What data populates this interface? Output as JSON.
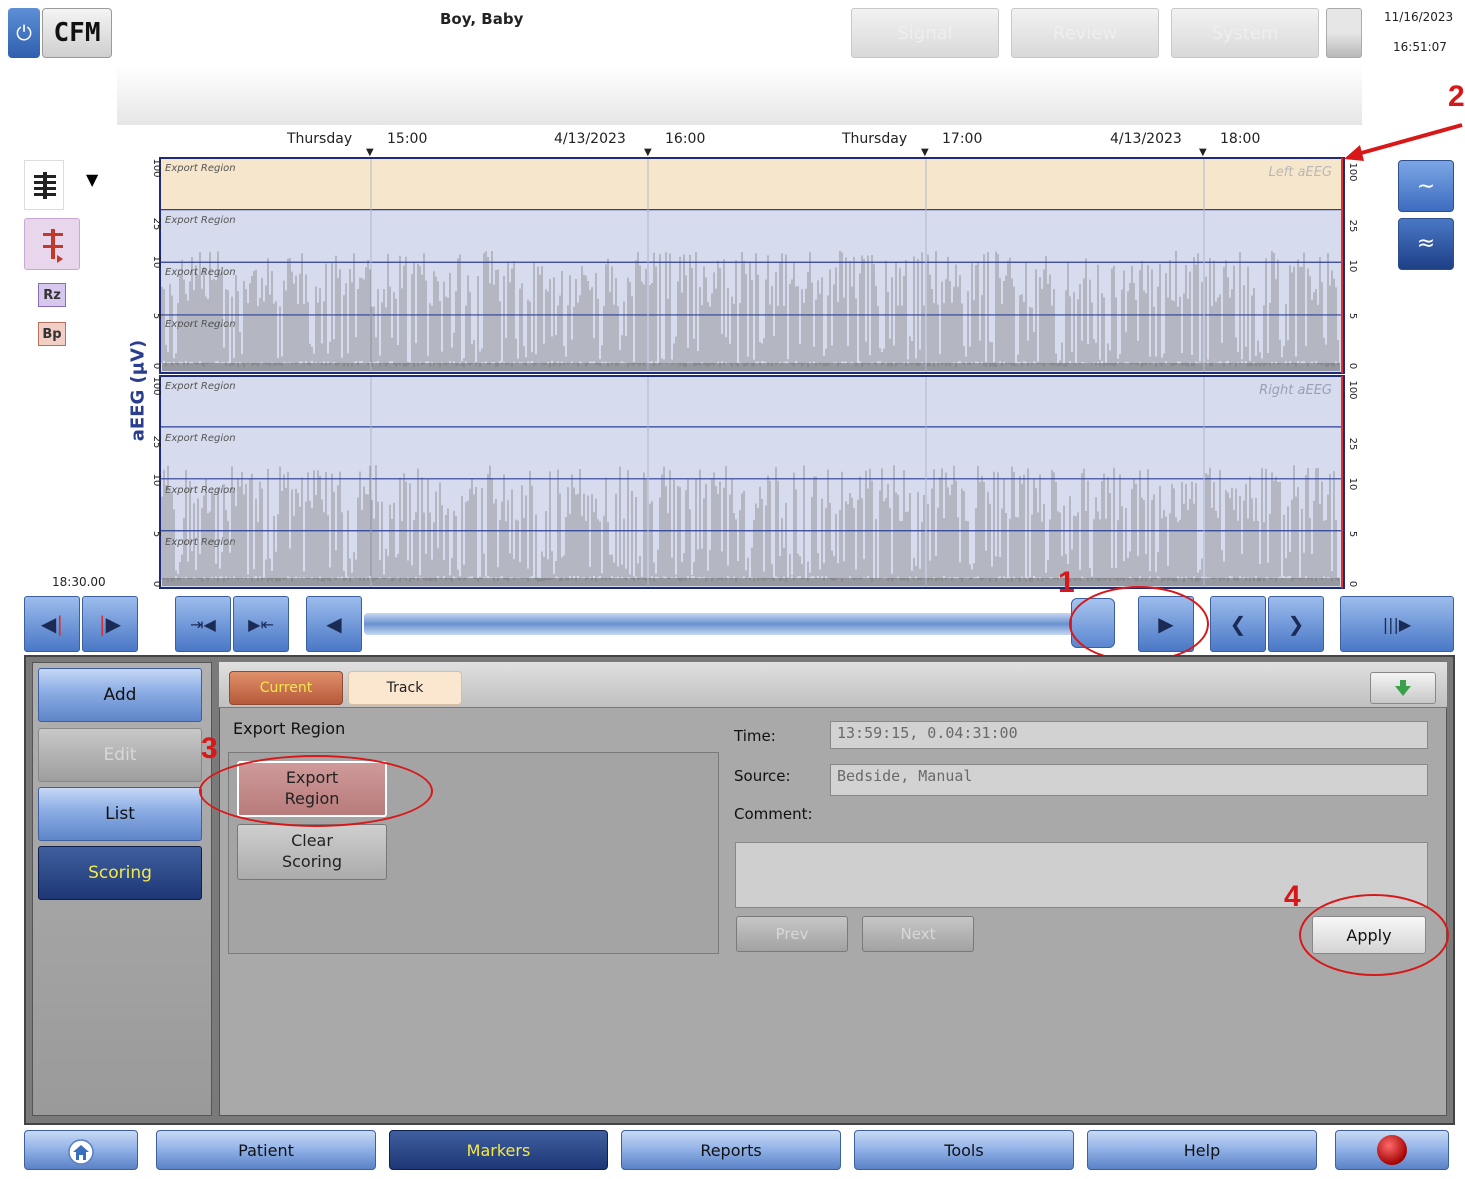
{
  "header": {
    "power_icon": "power-icon",
    "app_label": "CFM",
    "patient_name": "Boy, Baby",
    "mode_tabs": [
      "Signal",
      "Review",
      "System"
    ],
    "date": "11/16/2023",
    "time": "16:51:07"
  },
  "time_axis": {
    "labels": [
      "Thursday",
      "15:00",
      "4/13/2023",
      "16:00",
      "Thursday",
      "17:00",
      "4/13/2023",
      "18:00"
    ]
  },
  "left_tools": {
    "rz_label": "Rz",
    "bp_label": "Bp"
  },
  "chart": {
    "y_axis_label": "aEEG (µV)",
    "y_ticks": [
      "100",
      "25",
      "10",
      "5",
      "0"
    ],
    "region_label": "Export Region",
    "channels": [
      {
        "name": "Left aEEG",
        "highlighted": true
      },
      {
        "name": "Right aEEG",
        "highlighted": false
      }
    ],
    "cursor_time": "18:30.00",
    "colors": {
      "highlight": "#f6e6cc",
      "background": "#d6dced",
      "grid": "#2c3f96",
      "trace": "#7a7a7a",
      "border": "#1e2a7a",
      "marker": "#e03030"
    }
  },
  "slider": {
    "position_fraction": 0.97
  },
  "annotations": [
    "1",
    "2",
    "3",
    "4"
  ],
  "panel": {
    "side_buttons": {
      "add": "Add",
      "edit": "Edit",
      "list": "List",
      "scoring": "Scoring"
    },
    "tabs": {
      "current": "Current",
      "track": "Track"
    },
    "section_title": "Export Region",
    "marker_buttons": {
      "export_line1": "Export",
      "export_line2": "Region",
      "clear_line1": "Clear",
      "clear_line2": "Scoring"
    },
    "fields": {
      "time_label": "Time:",
      "time_value": "13:59:15, 0.04:31:00",
      "source_label": "Source:",
      "source_value": "Bedside, Manual",
      "comment_label": "Comment:"
    },
    "nav": {
      "prev": "Prev",
      "next": "Next"
    },
    "apply": "Apply"
  },
  "bottom_nav": {
    "patient": "Patient",
    "markers": "Markers",
    "reports": "Reports",
    "tools": "Tools",
    "help": "Help"
  }
}
